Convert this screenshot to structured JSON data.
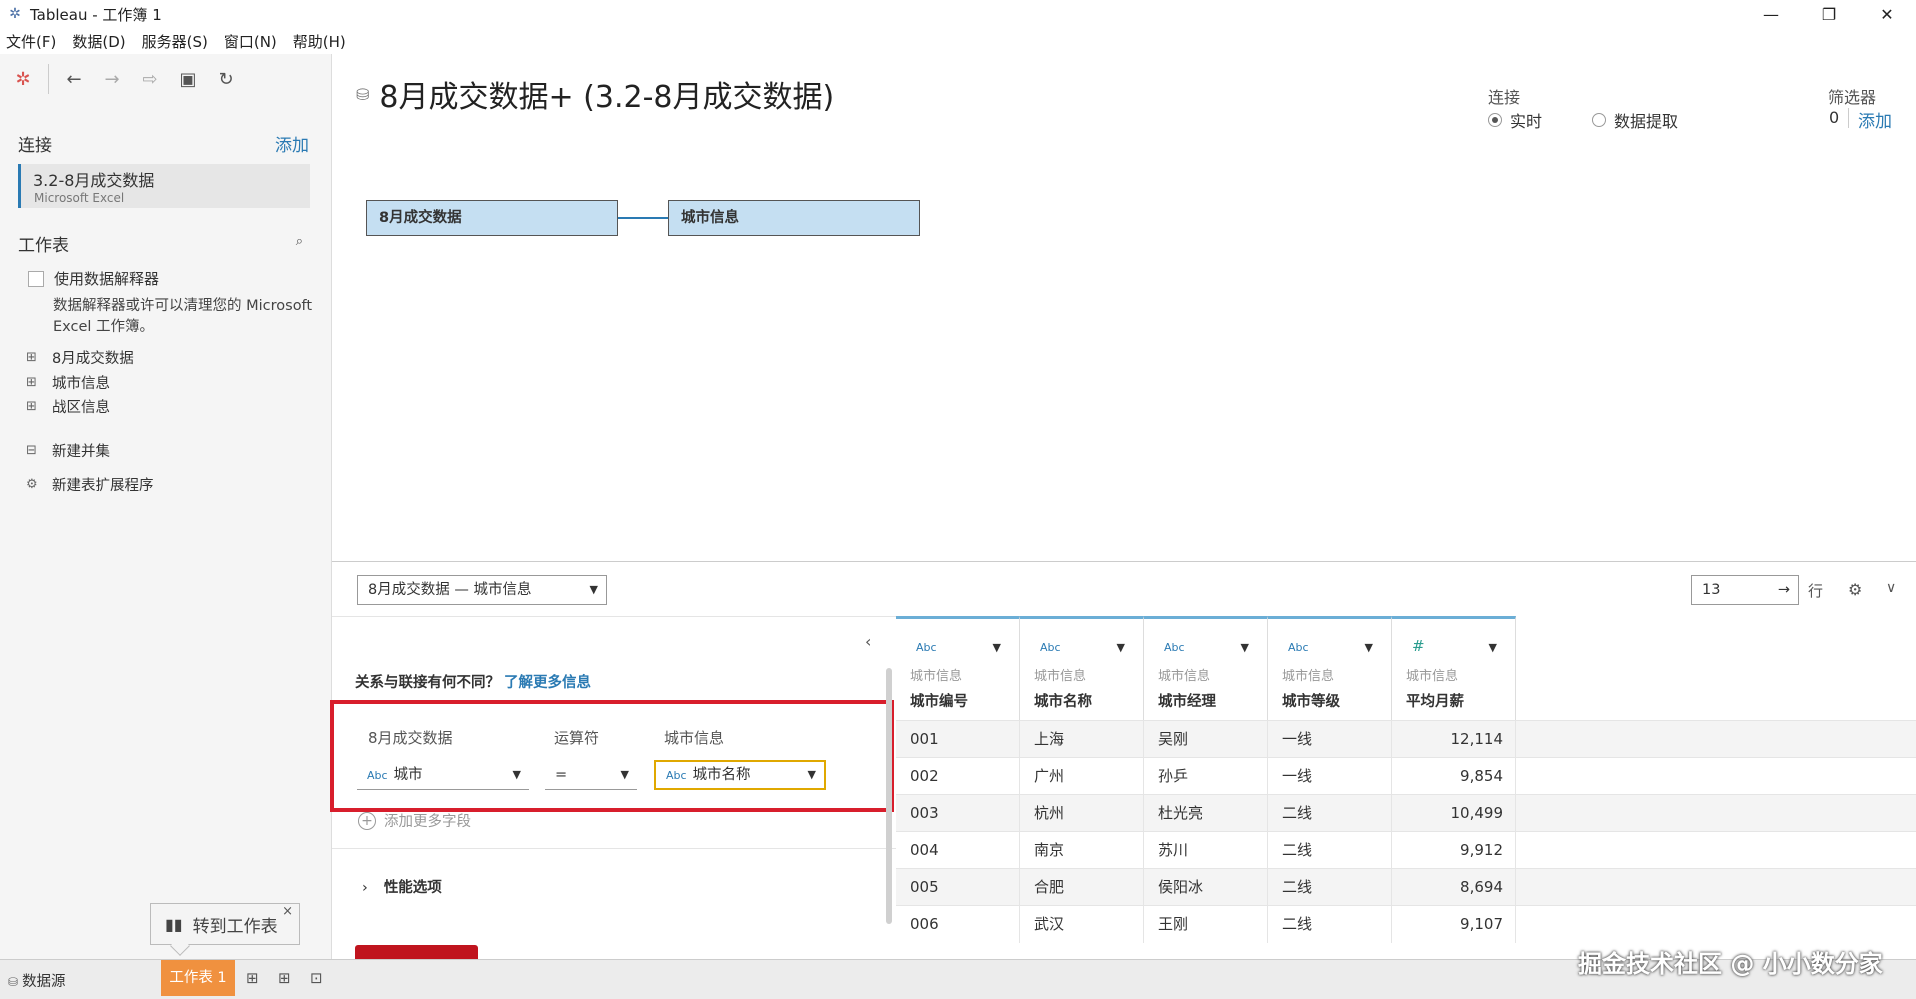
{
  "window": {
    "title": "Tableau - 工作簿 1",
    "minimize": "—",
    "maximize": "❐",
    "close": "✕"
  },
  "menu": [
    "文件(F)",
    "数据(D)",
    "服务器(S)",
    "窗口(N)",
    "帮助(H)"
  ],
  "sidebar": {
    "connections_label": "连接",
    "add_label": "添加",
    "connection": {
      "name": "3.2-8月成交数据",
      "type": "Microsoft Excel"
    },
    "sheets_label": "工作表",
    "interpreter_label": "使用数据解释器",
    "interpreter_desc": "数据解释器或许可以清理您的 Microsoft Excel 工作簿。",
    "sheets": [
      "8月成交数据",
      "城市信息",
      "战区信息"
    ],
    "new_union": "新建并集",
    "new_extension": "新建表扩展程序"
  },
  "datasource": {
    "title": "8月成交数据+ (3.2-8月成交数据)",
    "connection_label": "连接",
    "live_label": "实时",
    "extract_label": "数据提取",
    "filters_label": "筛选器",
    "filter_count": "0",
    "filter_add": "添加"
  },
  "canvas": {
    "left_table": "8月成交数据",
    "right_table": "城市信息"
  },
  "relationship": {
    "selector": "8月成交数据 — 城市信息",
    "diff_text": "关系与联接有何不同？",
    "learn_more": "了解更多信息",
    "left_col_label": "8月成交数据",
    "operator_label": "运算符",
    "right_col_label": "城市信息",
    "left_field": "城市",
    "operator": "=",
    "right_field": "城市名称",
    "abc": "Abc",
    "add_more": "添加更多字段",
    "performance": "性能选项"
  },
  "grid": {
    "rows_value": "13",
    "rows_label": "行",
    "columns": [
      {
        "type": "Abc",
        "source": "城市信息",
        "name": "城市编号"
      },
      {
        "type": "Abc",
        "source": "城市信息",
        "name": "城市名称"
      },
      {
        "type": "Abc",
        "source": "城市信息",
        "name": "城市经理"
      },
      {
        "type": "Abc",
        "source": "城市信息",
        "name": "城市等级"
      },
      {
        "type": "#",
        "source": "城市信息",
        "name": "平均月薪"
      }
    ],
    "rows": [
      [
        "001",
        "上海",
        "吴刚",
        "一线",
        "12,114"
      ],
      [
        "002",
        "广州",
        "孙乒",
        "一线",
        "9,854"
      ],
      [
        "003",
        "杭州",
        "杜光亮",
        "二线",
        "10,499"
      ],
      [
        "004",
        "南京",
        "苏川",
        "二线",
        "9,912"
      ],
      [
        "005",
        "合肥",
        "侯阳冰",
        "二线",
        "8,694"
      ],
      [
        "006",
        "武汉",
        "王刚",
        "二线",
        "9,107"
      ]
    ]
  },
  "tabs": {
    "datasource": "数据源",
    "sheet1": "工作表 1",
    "goto_sheet": "转到工作表"
  },
  "watermark": "掘金技术社区 @ 小小数分家"
}
